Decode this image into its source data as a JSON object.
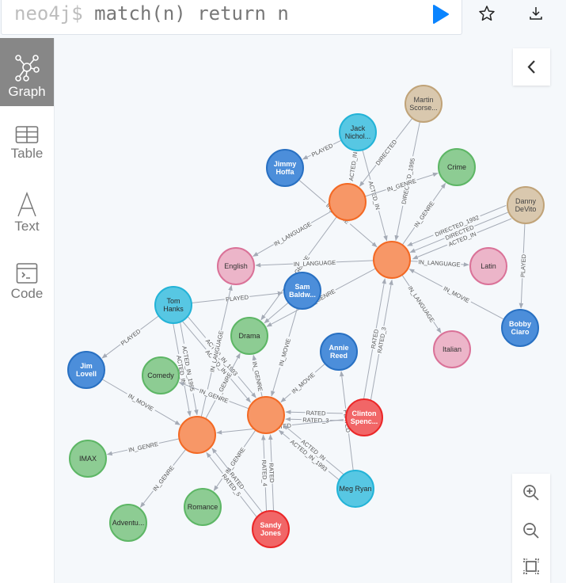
{
  "editor": {
    "prompt": "neo4j$",
    "query": "match(n) return n"
  },
  "toolbar": {
    "run_icon": "play-icon",
    "favorite_icon": "star-icon",
    "download_icon": "download-icon"
  },
  "sidebar": {
    "items": [
      {
        "label": "Graph",
        "icon": "graph-icon",
        "active": true
      },
      {
        "label": "Table",
        "icon": "table-icon",
        "active": false
      },
      {
        "label": "Text",
        "icon": "text-icon",
        "active": false
      },
      {
        "label": "Code",
        "icon": "code-icon",
        "active": false
      }
    ]
  },
  "controls": {
    "collapse_icon": "chevron-left-icon",
    "zoom_in_icon": "zoom-in-icon",
    "zoom_out_icon": "zoom-out-icon",
    "fit_icon": "fit-screen-icon"
  },
  "colors": {
    "movie": {
      "fill": "#f79767",
      "stroke": "#f36924",
      "text": "#ffffff"
    },
    "director": {
      "fill": "#d9c8ae",
      "stroke": "#c0a378",
      "text": "#444444"
    },
    "actor": {
      "fill": "#57c7e3",
      "stroke": "#23b3d7",
      "text": "#2a2a2a"
    },
    "role": {
      "fill": "#4c8eda",
      "stroke": "#2870c2",
      "text": "#ffffff"
    },
    "genre": {
      "fill": "#8dcc93",
      "stroke": "#5db665",
      "text": "#2a2a2a"
    },
    "language": {
      "fill": "#ecb5c9",
      "stroke": "#da7298",
      "text": "#333333"
    },
    "reviewer": {
      "fill": "#f16667",
      "stroke": "#eb2728",
      "text": "#ffffff"
    },
    "edge": "#a5abb6",
    "accent": "#0a84ff"
  },
  "graph": {
    "nodes": [
      {
        "id": "martin",
        "label": "Martin Scorse...",
        "type": "director"
      },
      {
        "id": "jack",
        "label": "Jack Nichol...",
        "type": "actor"
      },
      {
        "id": "jimmy",
        "label": "Jimmy Hoffa",
        "type": "role"
      },
      {
        "id": "crime",
        "label": "Crime",
        "type": "genre"
      },
      {
        "id": "m1",
        "label": "",
        "type": "movie"
      },
      {
        "id": "danny",
        "label": "Danny DeVito",
        "type": "director"
      },
      {
        "id": "m2",
        "label": "",
        "type": "movie"
      },
      {
        "id": "english",
        "label": "English",
        "type": "language"
      },
      {
        "id": "latin",
        "label": "Latin",
        "type": "language"
      },
      {
        "id": "sam",
        "label": "Sam Baldw...",
        "type": "role"
      },
      {
        "id": "tom",
        "label": "Tom Hanks",
        "type": "actor"
      },
      {
        "id": "drama",
        "label": "Drama",
        "type": "genre"
      },
      {
        "id": "bobby",
        "label": "Bobby Ciaro",
        "type": "role"
      },
      {
        "id": "italian",
        "label": "Italian",
        "type": "language"
      },
      {
        "id": "annie",
        "label": "Annie Reed",
        "type": "role"
      },
      {
        "id": "jim",
        "label": "Jim Lovell",
        "type": "role"
      },
      {
        "id": "comedy",
        "label": "Comedy",
        "type": "genre"
      },
      {
        "id": "m3",
        "label": "",
        "type": "movie"
      },
      {
        "id": "clinton",
        "label": "Clinton Spenc...",
        "type": "reviewer"
      },
      {
        "id": "m4",
        "label": "",
        "type": "movie"
      },
      {
        "id": "imax",
        "label": "IMAX",
        "type": "genre"
      },
      {
        "id": "meg",
        "label": "Meg Ryan",
        "type": "actor"
      },
      {
        "id": "romance",
        "label": "Romance",
        "type": "genre"
      },
      {
        "id": "adventure",
        "label": "Adventu...",
        "type": "genre"
      },
      {
        "id": "sandy",
        "label": "Sandy Jones",
        "type": "reviewer"
      }
    ],
    "edges": [
      {
        "from": "jack",
        "to": "jimmy",
        "label": "PLAYED"
      },
      {
        "from": "martin",
        "to": "m1",
        "label": "DIRECTED"
      },
      {
        "from": "martin",
        "to": "m2",
        "label": "DIRECTED_1995"
      },
      {
        "from": "jack",
        "to": "m1",
        "label": "ACTED_IN"
      },
      {
        "from": "jack",
        "to": "m2",
        "label": "ACTED_IN"
      },
      {
        "from": "jimmy",
        "to": "m2",
        "label": "IN_MOVIE"
      },
      {
        "from": "m1",
        "to": "crime",
        "label": "IN_GENRE"
      },
      {
        "from": "m1",
        "to": "english",
        "label": "IN_LANGUAGE"
      },
      {
        "from": "m1",
        "to": "drama",
        "label": "IN_GENRE"
      },
      {
        "from": "m2",
        "to": "crime",
        "label": "IN_GENRE"
      },
      {
        "from": "danny",
        "to": "m2",
        "label": "ACTED_IN"
      },
      {
        "from": "danny",
        "to": "m2",
        "label": "DIRECTED"
      },
      {
        "from": "danny",
        "to": "m2",
        "label": "DIRECTED_1992"
      },
      {
        "from": "m2",
        "to": "latin",
        "label": "IN_LANGUAGE"
      },
      {
        "from": "danny",
        "to": "bobby",
        "label": "PLAYED"
      },
      {
        "from": "bobby",
        "to": "m2",
        "label": "IN_MOVIE"
      },
      {
        "from": "m2",
        "to": "italian",
        "label": "IN_LANGUAGE"
      },
      {
        "from": "m2",
        "to": "english",
        "label": "IN_LANGUAGE"
      },
      {
        "from": "m2",
        "to": "drama",
        "label": "IN_GENRE"
      },
      {
        "from": "clinton",
        "to": "m2",
        "label": "RATED"
      },
      {
        "from": "clinton",
        "to": "m2",
        "label": "RATED_3"
      },
      {
        "from": "tom",
        "to": "sam",
        "label": "PLAYED"
      },
      {
        "from": "tom",
        "to": "jim",
        "label": "PLAYED"
      },
      {
        "from": "tom",
        "to": "m4",
        "label": "ACTED_IN"
      },
      {
        "from": "tom",
        "to": "m4",
        "label": "ACTED_IN_1995"
      },
      {
        "from": "tom",
        "to": "m3",
        "label": "ACTED_IN"
      },
      {
        "from": "tom",
        "to": "m3",
        "label": "ACTED_IN_1993"
      },
      {
        "from": "m4",
        "to": "english",
        "label": "IN_LANGUAGE"
      },
      {
        "from": "sam",
        "to": "drama",
        "label": ""
      },
      {
        "from": "sam",
        "to": "m3",
        "label": "IN_MOVIE"
      },
      {
        "from": "m3",
        "to": "drama",
        "label": "IN_GENRE"
      },
      {
        "from": "m4",
        "to": "drama",
        "label": "IN_GENRE"
      },
      {
        "from": "m3",
        "to": "comedy",
        "label": "IN_GENRE"
      },
      {
        "from": "jim",
        "to": "m4",
        "label": "IN_MOVIE"
      },
      {
        "from": "annie",
        "to": "m3",
        "label": "IN_MOVIE"
      },
      {
        "from": "clinton",
        "to": "m3",
        "label": "RATED_3"
      },
      {
        "from": "clinton",
        "to": "m3",
        "label": "RATED"
      },
      {
        "from": "clinton",
        "to": "m4",
        "label": "RATED"
      },
      {
        "from": "meg",
        "to": "annie",
        "label": "PLAYED"
      },
      {
        "from": "meg",
        "to": "m3",
        "label": "ACTED_IN"
      },
      {
        "from": "meg",
        "to": "m3",
        "label": "ACTED_IN_1993"
      },
      {
        "from": "m4",
        "to": "imax",
        "label": "IN_GENRE"
      },
      {
        "from": "m4",
        "to": "adventure",
        "label": "IN_GENRE"
      },
      {
        "from": "m3",
        "to": "romance",
        "label": "IN_GENRE"
      },
      {
        "from": "sandy",
        "to": "m4",
        "label": "RATED"
      },
      {
        "from": "sandy",
        "to": "m4",
        "label": "RATED_5"
      },
      {
        "from": "sandy",
        "to": "m3",
        "label": "RATED"
      },
      {
        "from": "sandy",
        "to": "m3",
        "label": "RATED_4"
      }
    ]
  }
}
